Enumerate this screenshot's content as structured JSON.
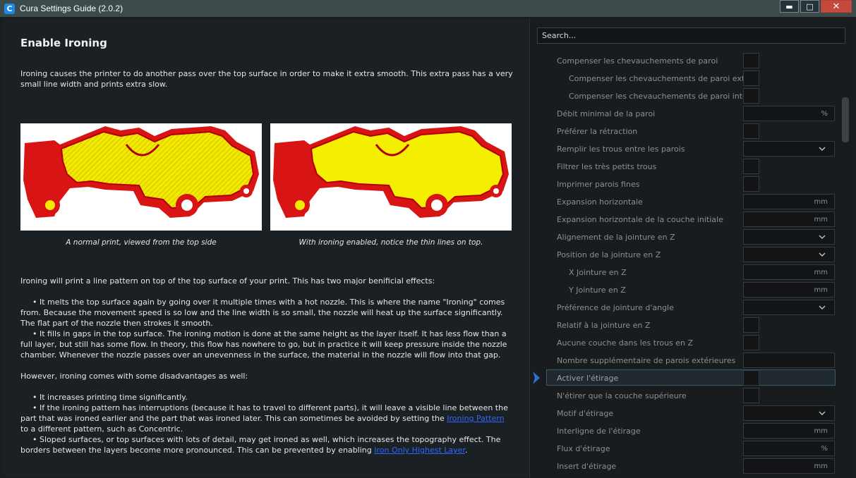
{
  "window": {
    "title": "Cura Settings Guide (2.0.2)",
    "icon_letter": "C",
    "controls": {
      "minimize": "▬",
      "maximize": "□",
      "close": "✕"
    }
  },
  "article": {
    "heading": "Enable Ironing",
    "intro": "Ironing causes the printer to do another pass over the top surface in order to make it extra smooth. This extra pass has a very small line width and prints extra slow.",
    "caption_left": "A normal print, viewed from the top side",
    "caption_right": "With ironing enabled, notice the thin lines on top.",
    "effects_intro": "Ironing will print a line pattern on top of the top surface of your print. This has two major benificial effects:",
    "effect_1": "• It melts the top surface again by going over it multiple times with a hot nozzle. This is where the name \"Ironing\" comes from. Because the movement speed is so low and the line width is so small, the nozzle will heat up the surface significantly. The flat part of the nozzle then strokes it smooth.",
    "effect_2": "• It fills in gaps in the top surface. The ironing motion is done at the same height as the layer itself. It has less flow than a full layer, but still has some flow. In theory, this flow has nowhere to go, but in practice it will keep pressure inside the nozzle chamber. Whenever the nozzle passes over an unevenness in the surface, the material in the nozzle will flow into that gap.",
    "disadv_intro": "However, ironing comes with some disadvantages as well:",
    "disadv_1": "• It increases printing time significantly.",
    "disadv_2_pre": "• If the ironing pattern has interruptions (because it has to travel to different parts), it will leave a visible line between the part that was ironed earlier and the part that was ironed later. This can sometimes be avoided by setting the ",
    "disadv_2_link": "Ironing Pattern",
    "disadv_2_post": " to a different pattern, such as Concentric.",
    "disadv_3_pre": "• Sloped surfaces, or top surfaces with lots of detail, may get ironed as well, which increases the topography effect. The borders between the layers become more pronounced. This can be prevented by enabling ",
    "disadv_3_link": "Iron Only Highest Layer",
    "disadv_3_post": "."
  },
  "settings": {
    "search_placeholder": "Search...",
    "active_index": 18,
    "items": [
      {
        "label": "Compenser les chevauchements de paroi",
        "indent": 0,
        "control": "checkbox",
        "unit": ""
      },
      {
        "label": "Compenser les chevauchements de paroi externe",
        "indent": 1,
        "control": "checkbox",
        "unit": ""
      },
      {
        "label": "Compenser les chevauchements de paroi intérieure",
        "indent": 1,
        "control": "checkbox",
        "unit": ""
      },
      {
        "label": "Débit minimal de la paroi",
        "indent": 0,
        "control": "field",
        "unit": "%"
      },
      {
        "label": "Préférer la rétraction",
        "indent": 0,
        "control": "checkbox",
        "unit": ""
      },
      {
        "label": "Remplir les trous entre les parois",
        "indent": 0,
        "control": "dropdown",
        "unit": ""
      },
      {
        "label": "Filtrer les très petits trous",
        "indent": 0,
        "control": "checkbox",
        "unit": ""
      },
      {
        "label": "Imprimer parois fines",
        "indent": 0,
        "control": "checkbox",
        "unit": ""
      },
      {
        "label": "Expansion horizontale",
        "indent": 0,
        "control": "field",
        "unit": "mm"
      },
      {
        "label": "Expansion horizontale de la couche initiale",
        "indent": 0,
        "control": "field",
        "unit": "mm"
      },
      {
        "label": "Alignement de la jointure en Z",
        "indent": 0,
        "control": "dropdown",
        "unit": ""
      },
      {
        "label": "Position de la jointure en Z",
        "indent": 0,
        "control": "dropdown",
        "unit": ""
      },
      {
        "label": "X Jointure en Z",
        "indent": 1,
        "control": "field",
        "unit": "mm"
      },
      {
        "label": "Y Jointure en Z",
        "indent": 1,
        "control": "field",
        "unit": "mm"
      },
      {
        "label": "Préférence de jointure d'angle",
        "indent": 0,
        "control": "dropdown",
        "unit": ""
      },
      {
        "label": "Relatif à la jointure en Z",
        "indent": 0,
        "control": "checkbox",
        "unit": ""
      },
      {
        "label": "Aucune couche dans les trous en Z",
        "indent": 0,
        "control": "checkbox",
        "unit": ""
      },
      {
        "label": "Nombre supplémentaire de parois extérieures",
        "indent": 0,
        "control": "field",
        "unit": ""
      },
      {
        "label": "Activer l'étirage",
        "indent": 0,
        "control": "checkbox",
        "unit": ""
      },
      {
        "label": "N'étirer que la couche supérieure",
        "indent": 0,
        "control": "checkbox",
        "unit": ""
      },
      {
        "label": "Motif d'étirage",
        "indent": 0,
        "control": "dropdown",
        "unit": ""
      },
      {
        "label": "Interligne de l'étirage",
        "indent": 0,
        "control": "field",
        "unit": "mm"
      },
      {
        "label": "Flux d'étirage",
        "indent": 0,
        "control": "field",
        "unit": "%"
      },
      {
        "label": "Insert d'étirage",
        "indent": 0,
        "control": "field",
        "unit": "mm"
      }
    ]
  },
  "colors": {
    "accent": "#2f6fd6",
    "print_red": "#d81414",
    "print_yellow": "#f2ea00",
    "link": "#3366ff"
  },
  "icons": {
    "active_marker": "chevron-right-icon",
    "dropdown": "chevron-down-icon"
  }
}
